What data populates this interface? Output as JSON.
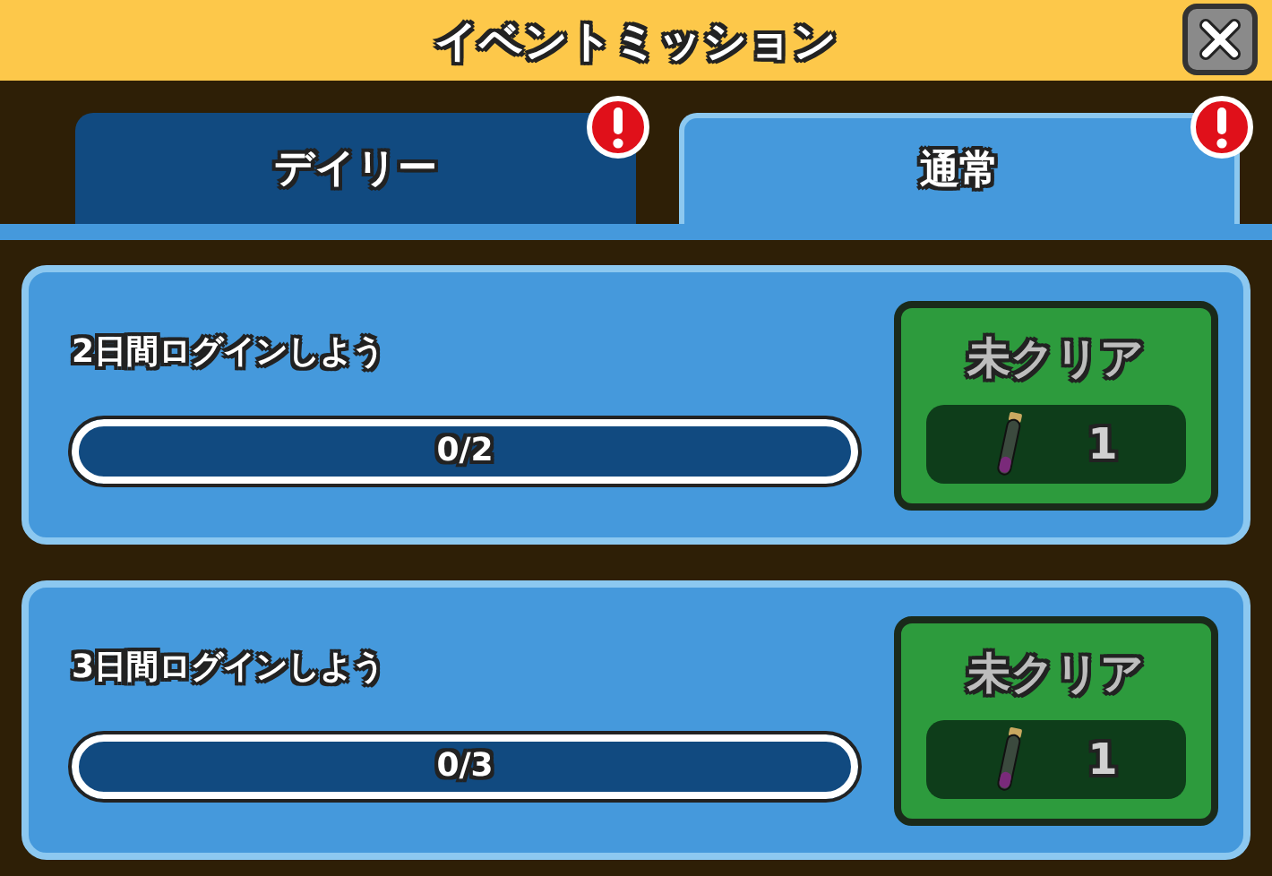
{
  "window": {
    "title": "イベントミッション"
  },
  "tabs": [
    {
      "label": "デイリー",
      "selected": false,
      "alert": true
    },
    {
      "label": "通常",
      "selected": true,
      "alert": true
    }
  ],
  "missions": [
    {
      "title": "2日間ログインしよう",
      "progress": "0/2",
      "level": 0,
      "status": "未クリア",
      "reward_count": "1"
    },
    {
      "title": "3日間ログインしよう",
      "progress": "0/3",
      "level": 0,
      "status": "未クリア",
      "reward_count": "1"
    }
  ]
}
